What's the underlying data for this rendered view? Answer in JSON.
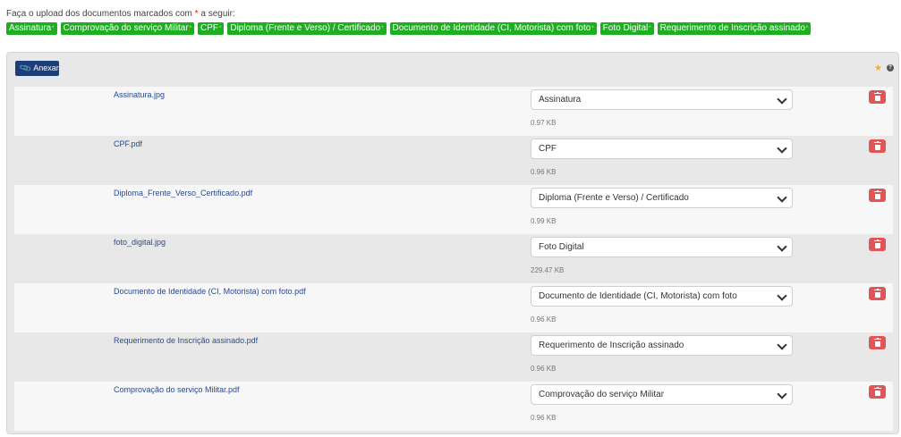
{
  "instructions": {
    "before": "Faça o upload dos documentos marcados com ",
    "star": "*",
    "after": " a seguir:"
  },
  "required_badges": [
    "Assinatura",
    "Comprovação do serviço Militar",
    "CPF",
    "Diploma (Frente e Verso) / Certificado",
    "Documento de Identidade (CI, Motorista) com foto",
    "Foto Digital",
    "Requerimento de Inscrição assinado"
  ],
  "badge_marker": "*",
  "panel": {
    "attach_label": "Anexar",
    "help_glyph": "?"
  },
  "files": [
    {
      "name": "Assinatura.jpg",
      "type": "Assinatura",
      "size": "0.97 KB"
    },
    {
      "name": "CPF.pdf",
      "type": "CPF",
      "size": "0.96 KB"
    },
    {
      "name": "Diploma_Frente_Verso_Certificado.pdf",
      "type": "Diploma (Frente e Verso) / Certificado",
      "size": "0.99 KB"
    },
    {
      "name": "foto_digital.jpg",
      "type": "Foto Digital",
      "size": "229.47 KB"
    },
    {
      "name": "Documento de Identidade (CI, Motorista) com foto.pdf",
      "type": "Documento de Identidade (CI, Motorista) com foto",
      "size": "0.96 KB"
    },
    {
      "name": "Requerimento de Inscrição assinado.pdf",
      "type": "Requerimento de Inscrição assinado",
      "size": "0.96 KB"
    },
    {
      "name": "Comprovação do serviço Militar.pdf",
      "type": "Comprovação do serviço Militar",
      "size": "0.96 KB"
    }
  ],
  "colors": {
    "badge_green": "#1fae22",
    "attach_blue": "#1c3f7c",
    "delete_red": "#e05656",
    "filename_blue": "#2a4a8a",
    "star_gold": "#f0b020"
  }
}
